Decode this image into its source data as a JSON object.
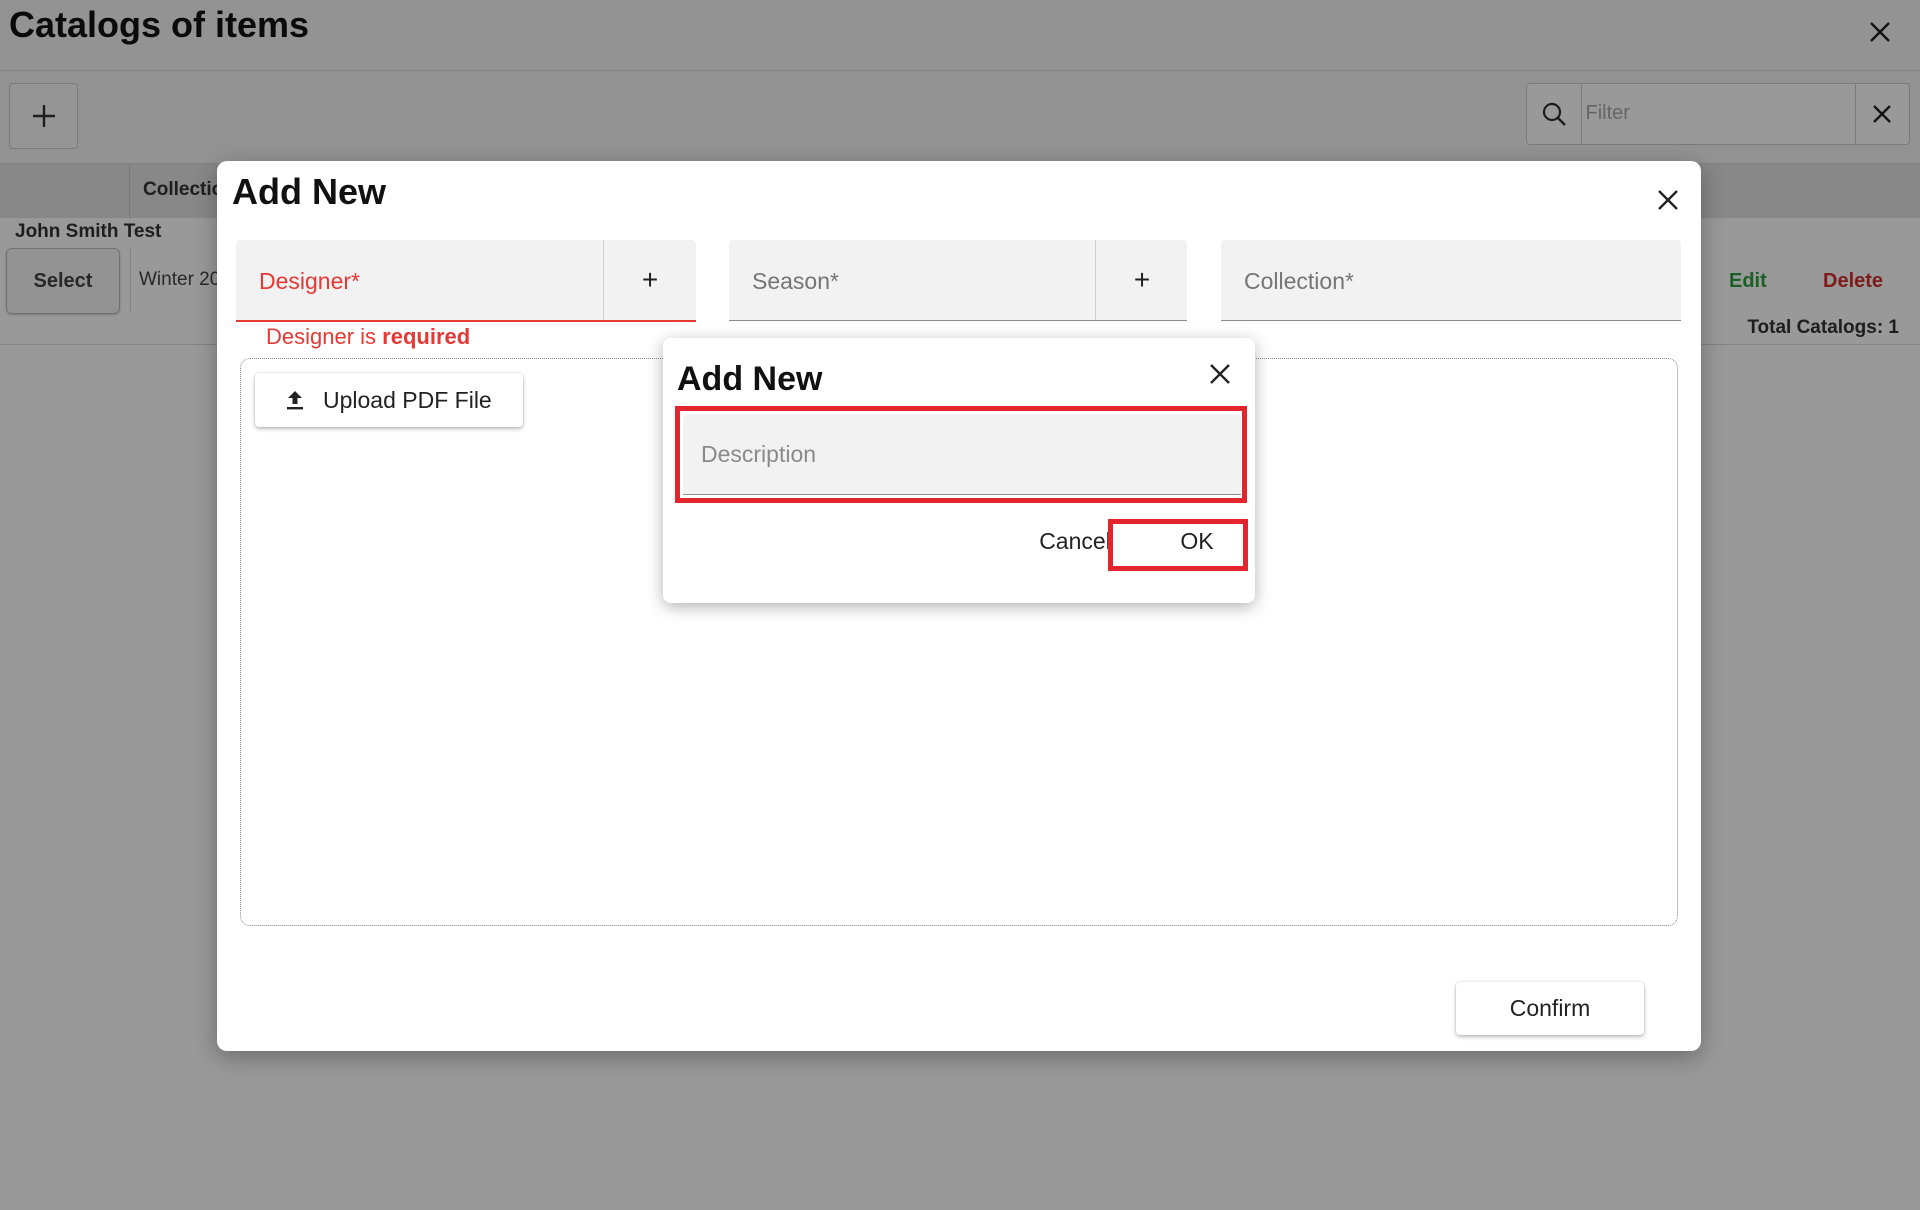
{
  "page": {
    "title": "Catalogs of items",
    "filter_placeholder": "Filter",
    "table": {
      "header_collection": "Collectio",
      "group_label": "John Smith Test",
      "row": {
        "select_label": "Select",
        "season_text": "Winter 20",
        "edit_label": "Edit",
        "delete_label": "Delete"
      },
      "total_text": "Total Catalogs: 1"
    }
  },
  "dialog": {
    "title": "Add New",
    "designer_label": "Designer*",
    "designer_add": "+",
    "season_label": "Season*",
    "season_add": "+",
    "collection_label": "Collection*",
    "error_prefix": "Designer is ",
    "error_bold": "required",
    "upload_label": "Upload PDF File",
    "confirm_label": "Confirm"
  },
  "subdialog": {
    "title": "Add New",
    "description_placeholder": "Description",
    "cancel_label": "Cancel",
    "ok_label": "OK"
  },
  "colors": {
    "error": "#e53935",
    "highlight": "#e3262d",
    "edit": "#2e9e3e",
    "delete": "#d32f2f"
  }
}
